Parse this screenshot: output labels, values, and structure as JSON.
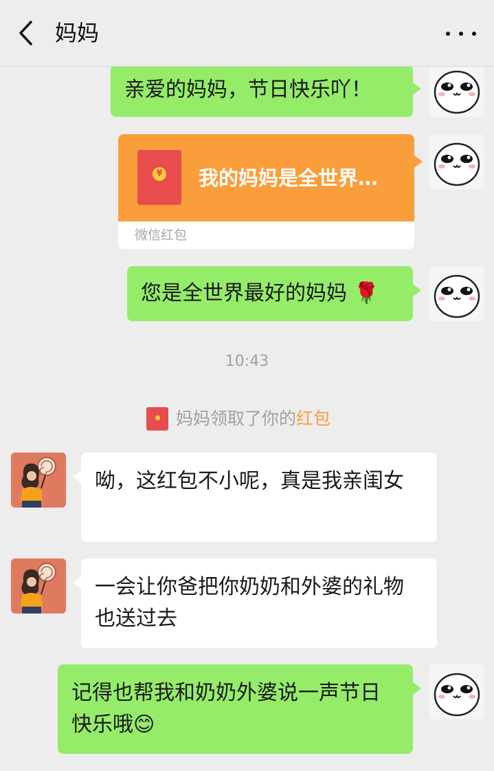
{
  "header": {
    "title": "妈妈",
    "back_icon": "chevron-left-icon",
    "more_icon": "more-dots-icon"
  },
  "messages": [
    {
      "sender": "self",
      "text": "亲爱的妈妈，节日快乐吖！"
    },
    {
      "sender": "self",
      "type": "red-packet",
      "text": "我的妈妈是全世界…",
      "label": "微信红包"
    },
    {
      "sender": "self",
      "text": "您是全世界最好的妈妈 🌹"
    },
    {
      "sender": "mom",
      "text": "呦，这红包不小呢，真是我亲闺女"
    },
    {
      "sender": "mom",
      "text": "一会让你爸把你奶奶和外婆的礼物也送过去"
    },
    {
      "sender": "self",
      "text": "记得也帮我和奶奶外婆说一声节日快乐哦😊"
    }
  ],
  "timestamp": "10:43",
  "notice": {
    "text": "妈妈领取了你的",
    "link": "红包"
  },
  "colors": {
    "self_bubble": "#95ec69",
    "red_packet": "#f99e3a",
    "accent_link": "#f99e3a"
  }
}
